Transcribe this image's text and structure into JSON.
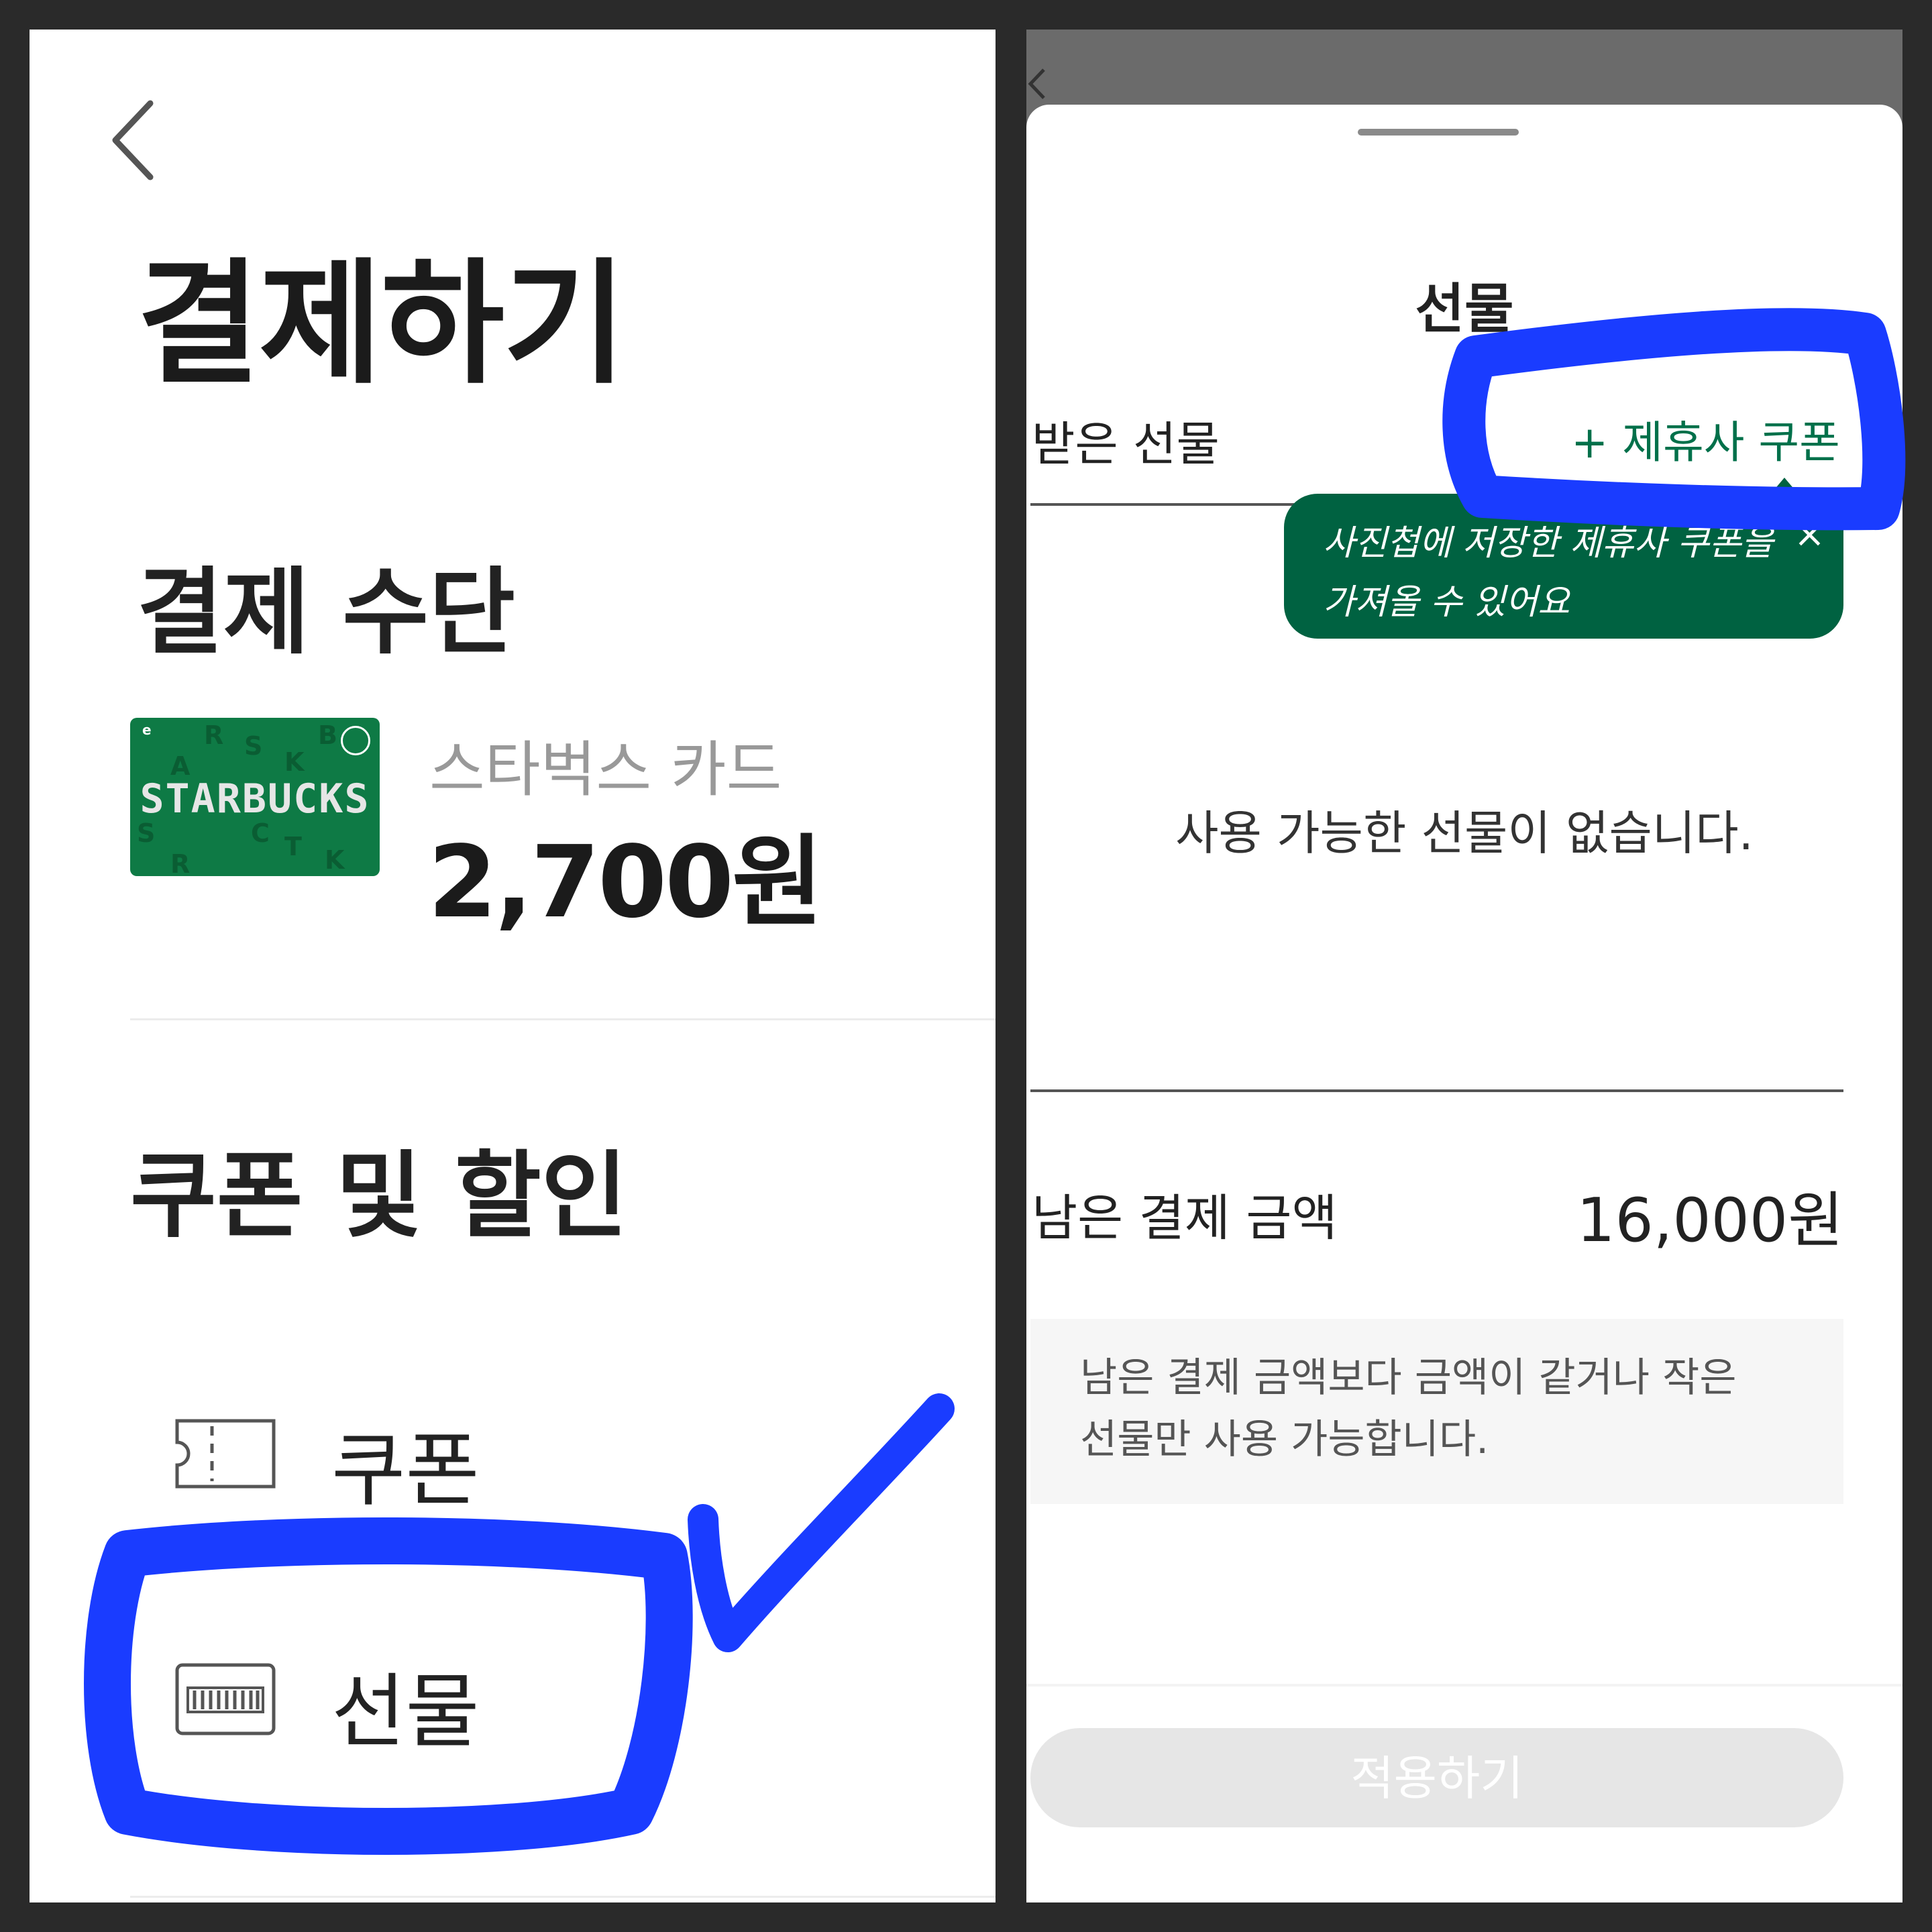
{
  "left_screen": {
    "page_title": "결제하기",
    "payment_method": {
      "section_title": "결제 수단",
      "card_name": "스타벅스 카드",
      "card_amount": "2,700원",
      "card_image_word": "STARBUCKS",
      "card_color": "#0e7a45"
    },
    "discounts": {
      "section_title": "쿠폰 및 할인",
      "items": [
        {
          "label": "쿠폰",
          "icon": "ticket-icon"
        },
        {
          "label": "선물",
          "icon": "gift-card-icon"
        }
      ]
    }
  },
  "right_screen": {
    "sheet_title": "선물",
    "received_tab": "받은 선물",
    "add_coupon": "+ 제휴사 쿠폰",
    "tooltip": {
      "line1": "사진첩에 저장한 제휴사 쿠폰을",
      "line2": "가져올 수 있어요",
      "close": "×",
      "color": "#006241"
    },
    "empty_message": "사용 가능한 선물이 없습니다.",
    "remaining": {
      "label": "남은 결제 금액",
      "value": "16,000원"
    },
    "notice": {
      "line1": "남은 결제 금액보다 금액이 같거나 작은",
      "line2": "선물만 사용 가능합니다."
    },
    "apply_button": "적용하기"
  },
  "annotation_color": "#1a3cff",
  "accent_green": "#00704a"
}
